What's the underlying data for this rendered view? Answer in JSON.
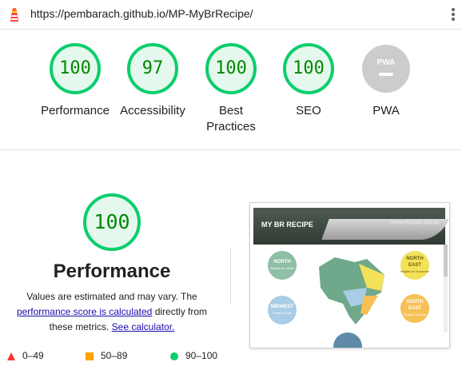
{
  "browser": {
    "url": "https://pembarach.github.io/MP-MyBrRecipe/"
  },
  "colors": {
    "pass": "#0cce6b",
    "pass_text": "#008800",
    "gray": "#cccccc",
    "fail": "#ff3333",
    "average": "#ffa400",
    "link": "#1a0dab"
  },
  "summary": {
    "categories": [
      {
        "id": "performance",
        "score": "100",
        "label": "Performance"
      },
      {
        "id": "accessibility",
        "score": "97",
        "label": "Accessibility"
      },
      {
        "id": "best-practices",
        "score": "100",
        "label": "Best Practices"
      },
      {
        "id": "seo",
        "score": "100",
        "label": "SEO"
      },
      {
        "id": "pwa",
        "badge": "PWA",
        "label": "PWA"
      }
    ]
  },
  "performance": {
    "score": "100",
    "title": "Performance",
    "desc_part1": "Values are estimated and may vary. The ",
    "desc_link1": "performance score is calculated",
    "desc_part2": " directly from these metrics. ",
    "desc_link2": "See calculator."
  },
  "legend": {
    "fail": "0–49",
    "average": "50–89",
    "pass": "90–100"
  },
  "screenshot": {
    "brand": "MY BR RECIPE",
    "nav": "Home   Recipes   Signup",
    "regions": [
      {
        "name": "NORTH",
        "sub": "Região do Norte",
        "color": "#8fbfa6"
      },
      {
        "name": "NORTH EAST",
        "sub": "Região do Nordeste",
        "color": "#f4e15a"
      },
      {
        "name": "MIDWEST",
        "sub": "Centro-Oeste",
        "color": "#a9cde6"
      },
      {
        "name": "SOUTH EAST",
        "sub": "Região Sudeste",
        "color": "#f7c056"
      }
    ]
  }
}
